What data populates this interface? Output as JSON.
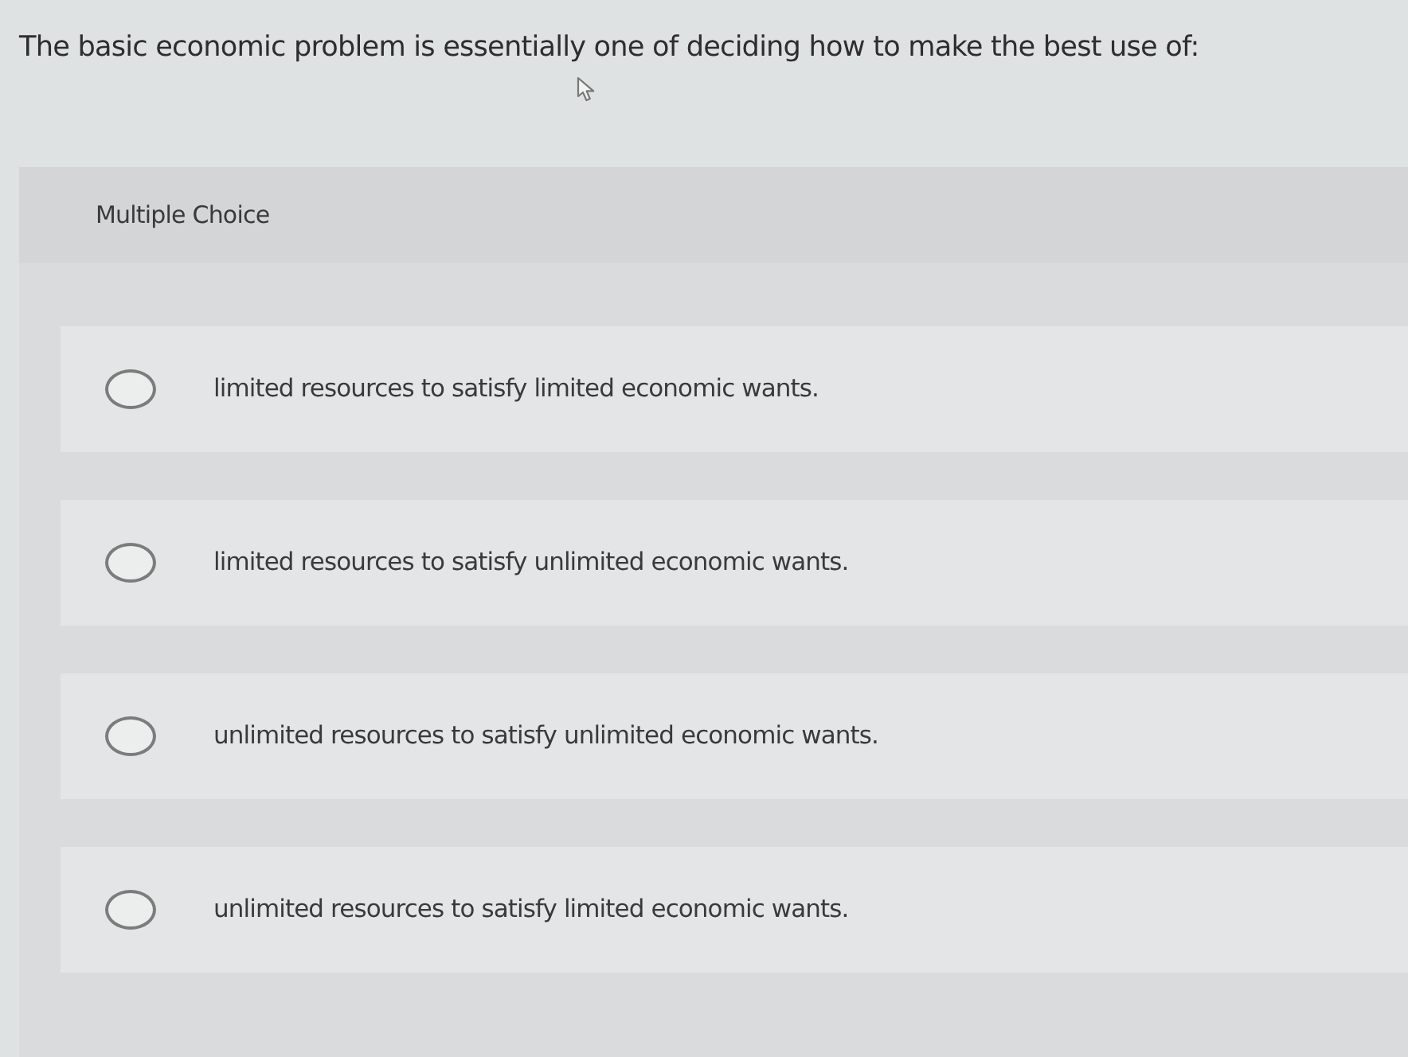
{
  "question": "The basic economic problem is essentially one of deciding how to make the best use of:",
  "question_type": "Multiple Choice",
  "options": [
    {
      "label": "limited resources to satisfy limited economic wants.",
      "selected": false
    },
    {
      "label": "limited resources to satisfy unlimited economic wants.",
      "selected": false
    },
    {
      "label": "unlimited resources to satisfy unlimited economic wants.",
      "selected": false
    },
    {
      "label": "unlimited resources to satisfy limited economic wants.",
      "selected": false
    }
  ]
}
